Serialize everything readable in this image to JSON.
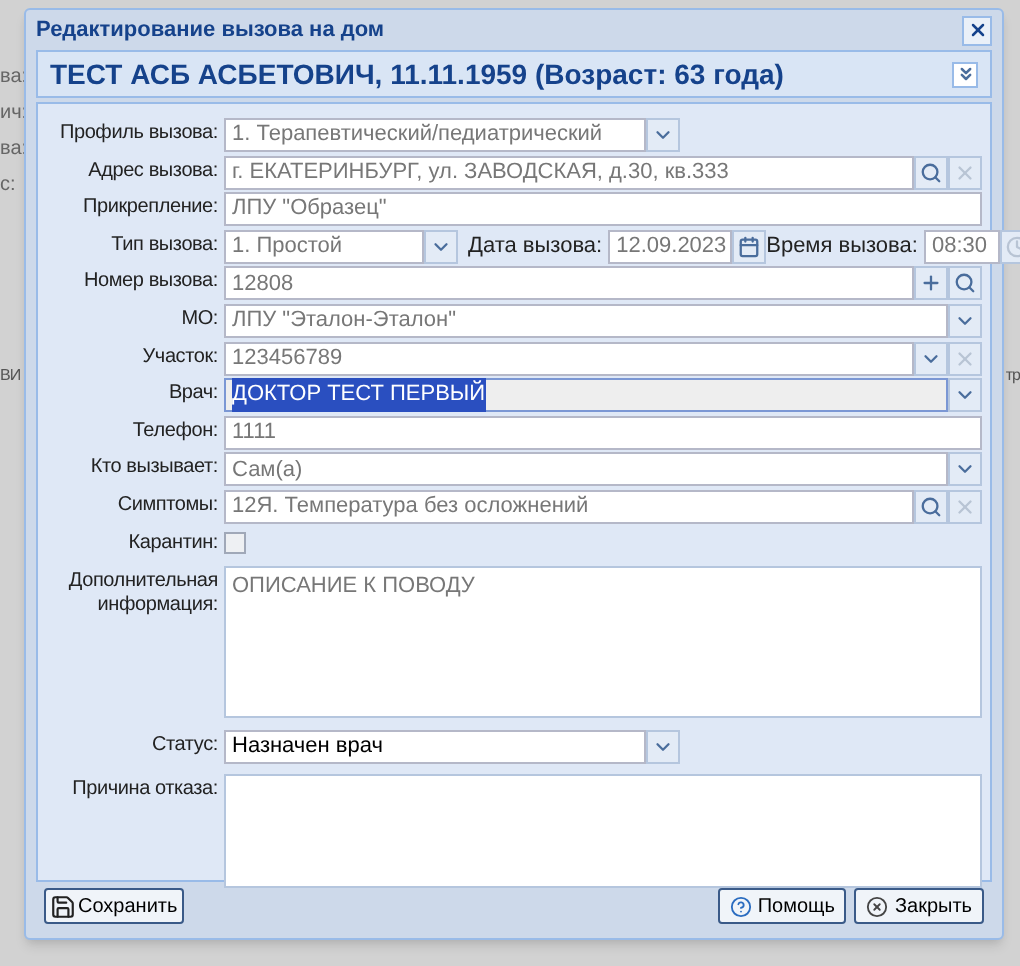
{
  "background": {
    "left_labels": [
      "ва:",
      "ич:",
      "ва:",
      "с:"
    ],
    "mid_left": "ВИ",
    "mid_right": "тр"
  },
  "dialog": {
    "title": "Редактирование вызова на дом",
    "header": "ТЕСТ АСБ АСБЕТОВИЧ, 11.11.1959 (Возраст: 63 года)"
  },
  "fields": [
    {
      "kind": "select",
      "label": "Профиль вызова:",
      "value": "1. Терапевтический/педиатрический",
      "disabled": true,
      "short": true
    },
    {
      "kind": "lookup",
      "label": "Адрес вызова:",
      "value": "г. ЕКАТЕРИНБУРГ, ул. ЗАВОДСКАЯ, д.30, кв.333",
      "disabled": true
    },
    {
      "kind": "text",
      "label": "Прикрепление:",
      "value": "ЛПУ \"Образец\"",
      "disabled": true
    },
    {
      "kind": "datetime",
      "label": "Тип вызова:",
      "value": "1. Простой",
      "disabled": true,
      "date_label": "Дата вызова:",
      "date": "12.09.2023",
      "time_label": "Время вызова:",
      "time": "08:30"
    },
    {
      "kind": "number",
      "label": "Номер вызова:",
      "value": "12808",
      "disabled": true
    },
    {
      "kind": "select",
      "label": "МО:",
      "value": "ЛПУ \"Эталон-Эталон\"",
      "disabled": true
    },
    {
      "kind": "select_clear",
      "label": "Участок:",
      "value": "123456789",
      "disabled": true
    },
    {
      "kind": "select",
      "label": "Врач:",
      "value": "ДОКТОР ТЕСТ ПЕРВЫЙ",
      "disabled": false,
      "focused": true
    },
    {
      "kind": "text",
      "label": "Телефон:",
      "value": "1111",
      "disabled": true
    },
    {
      "kind": "select",
      "label": "Кто вызывает:",
      "value": "Сам(а)",
      "disabled": true
    },
    {
      "kind": "lookup",
      "label": "Симптомы:",
      "value": "12Я. Температура без осложнений",
      "disabled": true
    },
    {
      "kind": "checkbox",
      "label": "Карантин:",
      "checked": false
    },
    {
      "kind": "textarea",
      "label": "Дополнительная информация:",
      "value": "ОПИСАНИЕ К ПОВОДУ",
      "disabled": true,
      "tall": true
    },
    {
      "kind": "select",
      "label": "Статус:",
      "value": "Назначен врач",
      "disabled": false,
      "short": true
    },
    {
      "kind": "textarea",
      "label": "Причина отказа:",
      "tall": false
    }
  ],
  "buttons": {
    "save": "Сохранить",
    "help": "Помощь",
    "close": "Закрыть"
  }
}
